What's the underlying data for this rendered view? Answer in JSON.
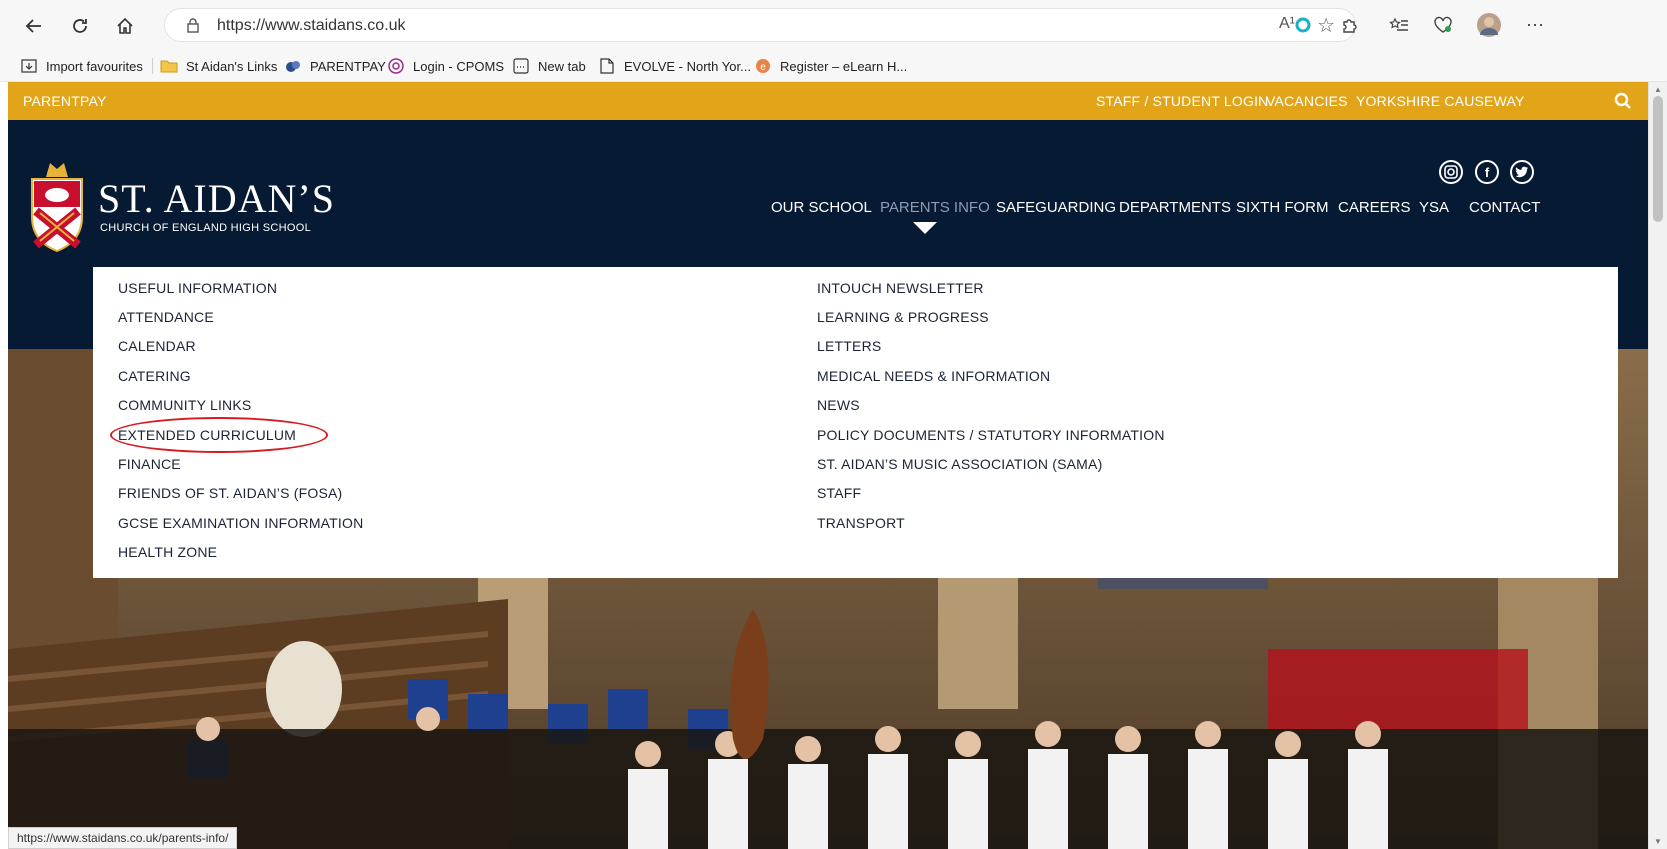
{
  "browser": {
    "url": "https://www.staidans.co.uk",
    "read_aloud_glyph": "A¹",
    "more_glyph": "⋯",
    "status_url": "https://www.staidans.co.uk/parents-info/"
  },
  "bookmarks": [
    {
      "label": "Import favourites",
      "icon": "import-icon"
    },
    {
      "label": "St Aidan's Links",
      "icon": "folder-icon"
    },
    {
      "label": "PARENTPAY",
      "icon": "parentpay-icon"
    },
    {
      "label": "Login - CPOMS",
      "icon": "cpoms-icon"
    },
    {
      "label": "New tab",
      "icon": "new-tab-icon"
    },
    {
      "label": "EVOLVE - North Yor...",
      "icon": "page-icon"
    },
    {
      "label": "Register – eLearn H...",
      "icon": "elearn-icon"
    }
  ],
  "topbar": {
    "left_link": "PARENTPAY",
    "links": [
      "STAFF / STUDENT LOGIN",
      "VACANCIES",
      "YORKSHIRE CAUSEWAY"
    ],
    "color": "#e2a519"
  },
  "brand": {
    "title": "ST. AIDAN’S",
    "subtitle": "CHURCH OF ENGLAND HIGH SCHOOL",
    "navy": "#071a33"
  },
  "nav": [
    {
      "label": "OUR SCHOOL",
      "active": false
    },
    {
      "label": "PARENTS INFO",
      "active": true
    },
    {
      "label": "SAFEGUARDING",
      "active": false
    },
    {
      "label": "DEPARTMENTS",
      "active": false
    },
    {
      "label": "SIXTH FORM",
      "active": false
    },
    {
      "label": "CAREERS",
      "active": false
    },
    {
      "label": "YSA",
      "active": false
    },
    {
      "label": "CONTACT",
      "active": false
    }
  ],
  "social": {
    "facebook_glyph": "f"
  },
  "dropdown": {
    "left": [
      "USEFUL INFORMATION",
      "ATTENDANCE",
      "CALENDAR",
      "CATERING",
      "COMMUNITY LINKS",
      "EXTENDED CURRICULUM",
      "FINANCE",
      "FRIENDS OF ST. AIDAN’S (FOSA)",
      "GCSE EXAMINATION INFORMATION",
      "HEALTH ZONE"
    ],
    "right": [
      "INTOUCH NEWSLETTER",
      "LEARNING & PROGRESS",
      "LETTERS",
      "MEDICAL NEEDS & INFORMATION",
      "NEWS",
      "POLICY DOCUMENTS / STATUTORY INFORMATION",
      "ST. AIDAN’S MUSIC ASSOCIATION (SAMA)",
      "STAFF",
      "TRANSPORT"
    ],
    "highlighted": "EXTENDED CURRICULUM",
    "highlight_color": "#d71a22"
  }
}
